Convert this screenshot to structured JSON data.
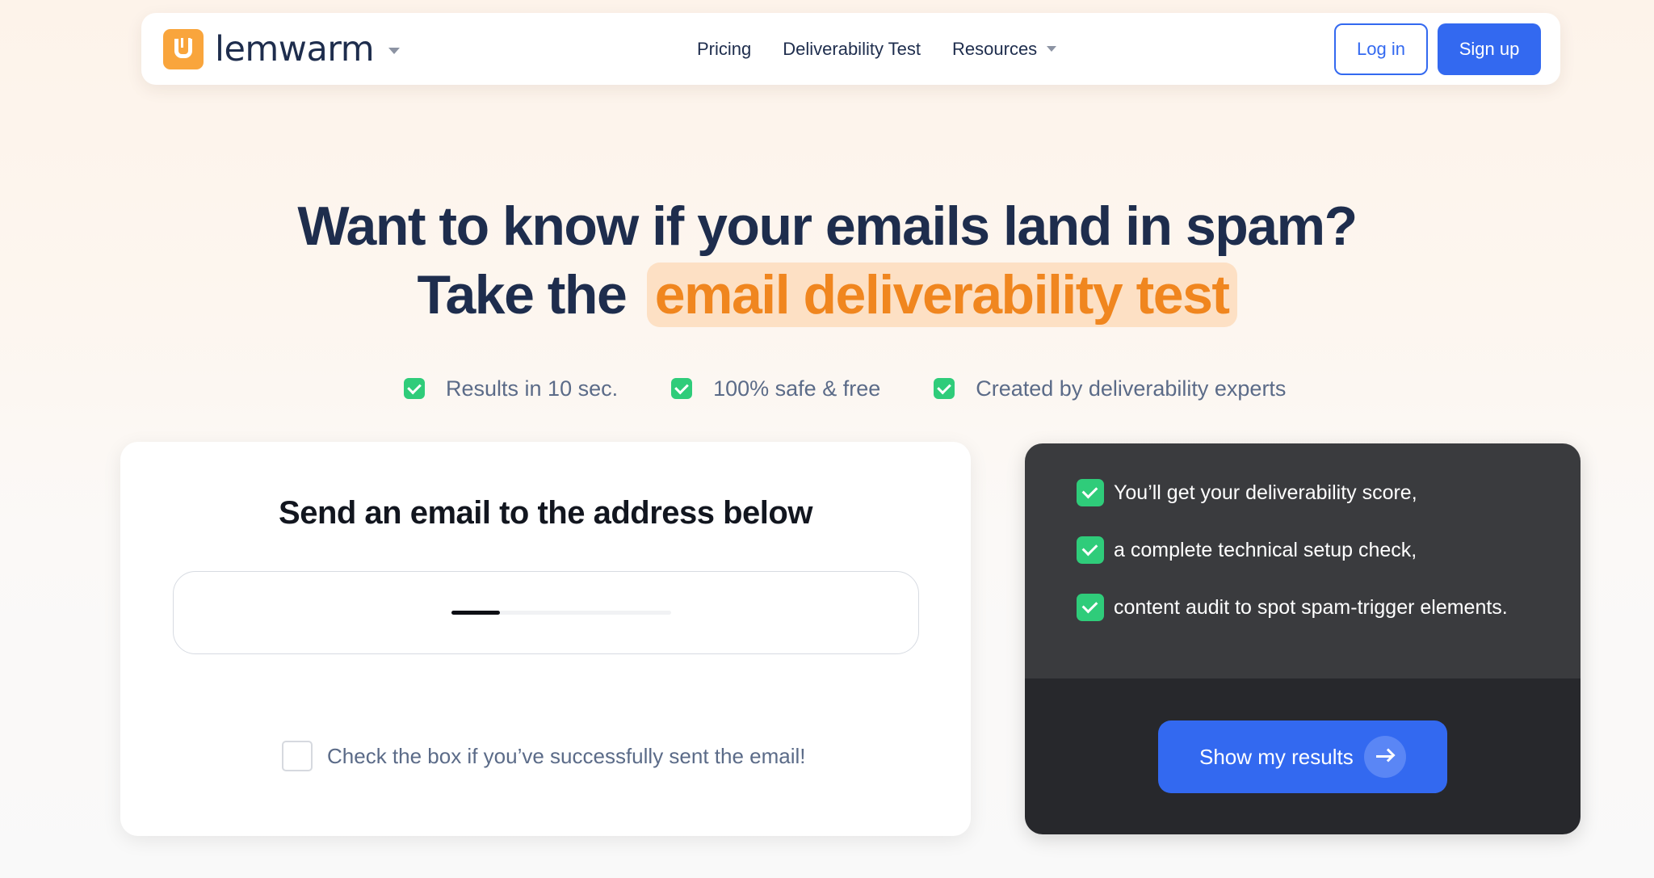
{
  "navbar": {
    "brand": "lemwarm",
    "links": [
      {
        "label": "Pricing"
      },
      {
        "label": "Deliverability Test"
      },
      {
        "label": "Resources"
      }
    ],
    "login_label": "Log in",
    "signup_label": "Sign up"
  },
  "hero": {
    "line1": "Want to know if your emails land in spam?",
    "line2_prefix": "Take the",
    "line2_highlight": "email deliverability test"
  },
  "features": [
    "Results in 10 sec.",
    "100% safe & free",
    "Created by deliverability experts"
  ],
  "left_card": {
    "title": "Send an email to the address below",
    "loading_progress": 0.22,
    "confirm_label": "Check the box if you’ve successfully sent the email!",
    "confirm_checked": false
  },
  "right_card": {
    "benefits": [
      "You’ll get your deliverability score,",
      "a complete technical setup check,",
      "content audit to spot spam-trigger elements."
    ],
    "button_label": "Show my results"
  },
  "colors": {
    "brand_orange": "#f9a53c",
    "primary_blue": "#3369f0",
    "check_green": "#2fcc7a",
    "highlight_bg": "#fde0c4",
    "highlight_text": "#f0861f",
    "dark_panel": "#3a3b3e",
    "darker_panel": "#27282c"
  },
  "icons": {
    "logo": "lemwarm-u-logo-icon",
    "caret": "chevron-down-icon",
    "check": "check-icon",
    "arrow": "arrow-right-icon"
  }
}
